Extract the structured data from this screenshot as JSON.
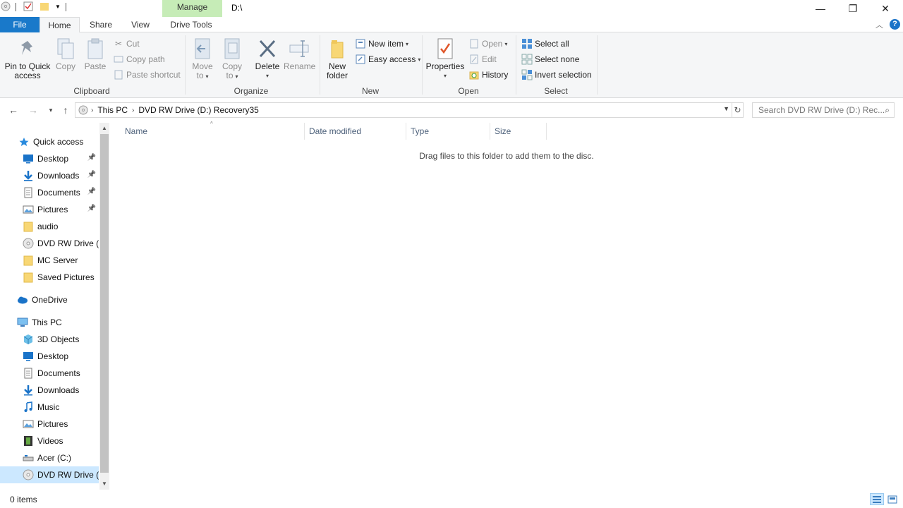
{
  "window": {
    "title": "D:\\",
    "context_tab": "Manage",
    "controls": {
      "minimize": "—",
      "maximize": "❐",
      "close": "✕"
    }
  },
  "ribbon_tabs": {
    "file": "File",
    "home": "Home",
    "share": "Share",
    "view": "View",
    "drive_tools": "Drive Tools",
    "help": "?"
  },
  "ribbon": {
    "clipboard": {
      "label": "Clipboard",
      "pin_line1": "Pin to Quick",
      "pin_line2": "access",
      "copy": "Copy",
      "paste": "Paste",
      "cut": "Cut",
      "copy_path": "Copy path",
      "paste_shortcut": "Paste shortcut"
    },
    "organize": {
      "label": "Organize",
      "move_to_line1": "Move",
      "move_to_line2": "to",
      "copy_to_line1": "Copy",
      "copy_to_line2": "to",
      "delete": "Delete",
      "rename": "Rename"
    },
    "new": {
      "label": "New",
      "new_folder_line1": "New",
      "new_folder_line2": "folder",
      "new_item": "New item",
      "easy_access": "Easy access"
    },
    "open": {
      "label": "Open",
      "properties": "Properties",
      "open": "Open",
      "edit": "Edit",
      "history": "History"
    },
    "select": {
      "label": "Select",
      "select_all": "Select all",
      "select_none": "Select none",
      "invert_selection": "Invert selection"
    }
  },
  "address": {
    "breadcrumbs": [
      "This PC",
      "DVD RW Drive (D:) Recovery35"
    ],
    "search_placeholder": "Search DVD RW Drive (D:) Rec..."
  },
  "nav_pane": {
    "quick_access": "Quick access",
    "quick_items": [
      {
        "label": "Desktop",
        "icon": "desktop-icon",
        "pinned": true
      },
      {
        "label": "Downloads",
        "icon": "downloads-icon",
        "pinned": true
      },
      {
        "label": "Documents",
        "icon": "documents-icon",
        "pinned": true
      },
      {
        "label": "Pictures",
        "icon": "pictures-icon",
        "pinned": true
      },
      {
        "label": "audio",
        "icon": "folder-icon",
        "pinned": false
      },
      {
        "label": "DVD RW Drive (D",
        "icon": "dvd-drive-icon",
        "pinned": false
      },
      {
        "label": "MC Server",
        "icon": "folder-icon",
        "pinned": false
      },
      {
        "label": "Saved Pictures",
        "icon": "folder-icon",
        "pinned": false
      }
    ],
    "onedrive": "OneDrive",
    "this_pc": "This PC",
    "pc_items": [
      {
        "label": "3D Objects",
        "icon": "3d-objects-icon"
      },
      {
        "label": "Desktop",
        "icon": "desktop-icon"
      },
      {
        "label": "Documents",
        "icon": "documents-icon"
      },
      {
        "label": "Downloads",
        "icon": "downloads-icon"
      },
      {
        "label": "Music",
        "icon": "music-icon"
      },
      {
        "label": "Pictures",
        "icon": "pictures-icon"
      },
      {
        "label": "Videos",
        "icon": "videos-icon"
      },
      {
        "label": "Acer (C:)",
        "icon": "hard-drive-icon"
      },
      {
        "label": "DVD RW Drive (D",
        "icon": "dvd-drive-icon"
      }
    ]
  },
  "file_list": {
    "columns": [
      "Name",
      "Date modified",
      "Type",
      "Size"
    ],
    "empty_message": "Drag files to this folder to add them to the disc."
  },
  "status": {
    "item_count": "0 items"
  },
  "colors": {
    "file_tab": "#1979ca",
    "manage_tab": "#c6ecb7",
    "selection": "#cce8ff",
    "column_header_text": "#4c607a"
  }
}
